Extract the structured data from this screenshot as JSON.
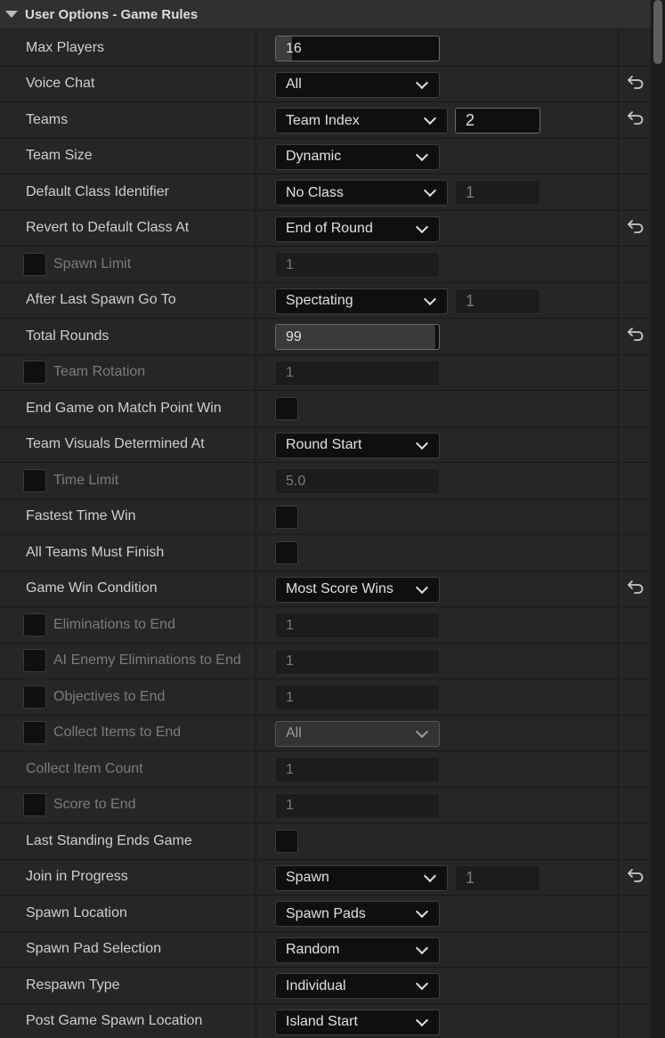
{
  "header": {
    "title": "User Options - Game Rules"
  },
  "rows": [
    {
      "label": "Max Players",
      "value": "16",
      "kind": "slider",
      "slider": 0.1,
      "reset": false
    },
    {
      "label": "Voice Chat",
      "value": "All",
      "kind": "dropdown",
      "reset": true
    },
    {
      "label": "Teams",
      "value": "Team Index",
      "kind": "dropdown-num",
      "num": "2",
      "num_active": true,
      "reset": true
    },
    {
      "label": "Team Size",
      "value": "Dynamic",
      "kind": "dropdown",
      "reset": false
    },
    {
      "label": "Default Class Identifier",
      "value": "No Class",
      "kind": "dropdown-num",
      "num": "1",
      "num_active": false,
      "reset": false
    },
    {
      "label": "Revert to Default Class At",
      "value": "End of Round",
      "kind": "dropdown",
      "reset": true
    },
    {
      "label": "Spawn Limit",
      "value": "1",
      "kind": "text-dim",
      "check": true,
      "dim": true,
      "reset": false
    },
    {
      "label": "After Last Spawn Go To",
      "value": "Spectating",
      "kind": "dropdown-num",
      "num": "1",
      "num_active": false,
      "reset": false
    },
    {
      "label": "Total Rounds",
      "value": "99",
      "kind": "slider",
      "slider": 0.98,
      "reset": true
    },
    {
      "label": "Team Rotation",
      "value": "1",
      "kind": "text-dim",
      "check": true,
      "dim": true,
      "reset": false
    },
    {
      "label": "End Game on Match Point Win",
      "kind": "checkbox",
      "reset": false
    },
    {
      "label": "Team Visuals Determined At",
      "value": "Round Start",
      "kind": "dropdown",
      "reset": false
    },
    {
      "label": "Time Limit",
      "value": "5.0",
      "kind": "text-dim",
      "check": true,
      "dim": true,
      "reset": false
    },
    {
      "label": "Fastest Time Win",
      "kind": "checkbox",
      "reset": false
    },
    {
      "label": "All Teams Must Finish",
      "kind": "checkbox",
      "reset": false
    },
    {
      "label": "Game Win Condition",
      "value": "Most Score Wins",
      "kind": "dropdown",
      "reset": true
    },
    {
      "label": "Eliminations to End",
      "value": "1",
      "kind": "text",
      "check": true,
      "dim": true,
      "reset": false
    },
    {
      "label": "AI Enemy Eliminations to End",
      "value": "1",
      "kind": "text",
      "check": true,
      "dim": true,
      "reset": false
    },
    {
      "label": "Objectives to End",
      "value": "1",
      "kind": "text",
      "check": true,
      "dim": true,
      "reset": false
    },
    {
      "label": "Collect Items to End",
      "value": "All",
      "kind": "dropdown-light",
      "check": true,
      "dim": true,
      "reset": false
    },
    {
      "label": "Collect Item Count",
      "value": "1",
      "kind": "text",
      "dim": true,
      "reset": false
    },
    {
      "label": "Score to End",
      "value": "1",
      "kind": "text",
      "check": true,
      "dim": true,
      "reset": false
    },
    {
      "label": "Last Standing Ends Game",
      "kind": "checkbox",
      "reset": false
    },
    {
      "label": "Join in Progress",
      "value": "Spawn",
      "kind": "dropdown-num",
      "num": "1",
      "num_active": false,
      "reset": true
    },
    {
      "label": "Spawn Location",
      "value": "Spawn Pads",
      "kind": "dropdown",
      "reset": false
    },
    {
      "label": "Spawn Pad Selection",
      "value": "Random",
      "kind": "dropdown",
      "reset": false
    },
    {
      "label": "Respawn Type",
      "value": "Individual",
      "kind": "dropdown",
      "reset": false
    },
    {
      "label": "Post Game Spawn Location",
      "value": "Island Start",
      "kind": "dropdown",
      "reset": false
    }
  ]
}
